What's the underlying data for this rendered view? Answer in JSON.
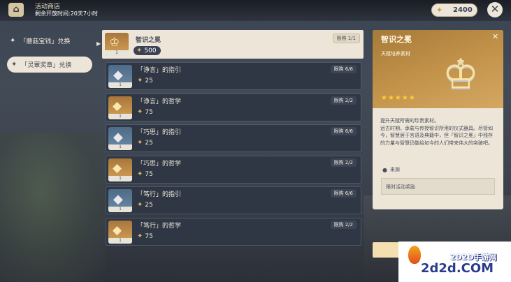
{
  "header": {
    "shop_icon": "shop-icon",
    "shop_title": "活动商店",
    "remaining_time": "剩余开放时间:20天7小时",
    "currency_icon": "medal-icon",
    "currency_amount": "2400",
    "close_icon": "close-icon"
  },
  "sidebar": {
    "items": [
      {
        "label": "「蘑菇宝钱」兑换",
        "selected": false
      },
      {
        "label": "「灵蕈奖章」兑换",
        "selected": true
      }
    ]
  },
  "shop": {
    "items": [
      {
        "name": "智识之冕",
        "price": "500",
        "limit": "限购 1/1",
        "count": "1",
        "thumb": "gold",
        "icon": "crown-icon",
        "selected": true
      },
      {
        "name": "「诤言」的指引",
        "price": "25",
        "limit": "限购 6/6",
        "count": "1",
        "thumb": "blue",
        "icon": "book-icon"
      },
      {
        "name": "「诤言」的哲学",
        "price": "75",
        "limit": "限购 2/2",
        "count": "1",
        "thumb": "purple",
        "icon": "book-icon"
      },
      {
        "name": "「巧思」的指引",
        "price": "25",
        "limit": "限购 6/6",
        "count": "1",
        "thumb": "blue",
        "icon": "book-icon"
      },
      {
        "name": "「巧思」的哲学",
        "price": "75",
        "limit": "限购 2/2",
        "count": "1",
        "thumb": "purple",
        "icon": "book-icon"
      },
      {
        "name": "「笃行」的指引",
        "price": "25",
        "limit": "限购 6/6",
        "count": "1",
        "thumb": "blue",
        "icon": "book-icon"
      },
      {
        "name": "「笃行」的哲学",
        "price": "75",
        "limit": "限购 2/2",
        "count": "1",
        "thumb": "purple",
        "icon": "book-icon"
      }
    ]
  },
  "detail": {
    "name": "智识之冕",
    "type": "天赋培养素材",
    "rarity": 5,
    "rarity_text": "★★★★★",
    "description": [
      "提升天赋所需的珍贵素材。",
      "远古时期，承载与传授智识所用的仪式器具。尽管如今，智慧居于言语及典籍中，但「智识之冕」中残存的力量与智慧仍能给如今的人们带来伟大的突破吧。"
    ],
    "source_label": "来源",
    "source_value": "限时活动奖励"
  },
  "watermark": {
    "site_cn": "2D2D手游网",
    "site_en": "2d2d.COM"
  }
}
